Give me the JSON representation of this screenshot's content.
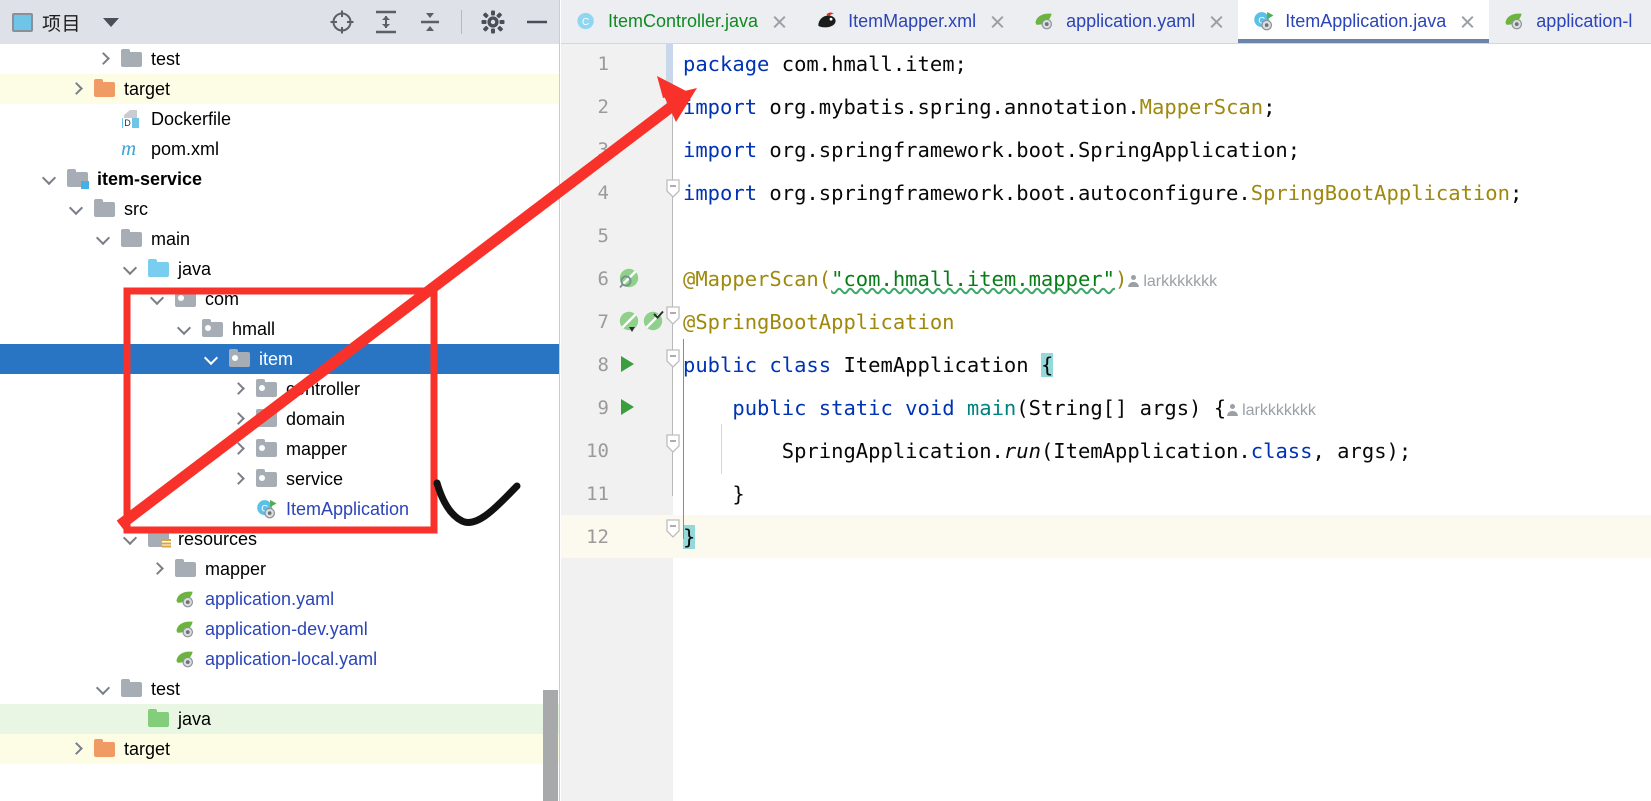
{
  "sidebar": {
    "header": {
      "title": "项目",
      "project_icon": "project-window-icon",
      "caret": "chevron-down-icon",
      "tools": [
        {
          "name": "locate-icon",
          "label": "Select Opened File"
        },
        {
          "name": "expand-all-icon",
          "label": "Expand All"
        },
        {
          "name": "collapse-all-icon",
          "label": "Collapse All"
        },
        {
          "name": "gear-icon",
          "label": "Settings"
        },
        {
          "name": "minimize-icon",
          "label": "Hide"
        }
      ]
    },
    "tree": [
      {
        "label": "test",
        "indent": 3,
        "chevron": "right",
        "icon": "folder-grey",
        "state": "normal"
      },
      {
        "label": "target",
        "indent": 2,
        "chevron": "right",
        "icon": "folder-orange",
        "state": "yellow"
      },
      {
        "label": "Dockerfile",
        "indent": 3,
        "chevron": "none",
        "icon": "docker-file",
        "state": "normal"
      },
      {
        "label": "pom.xml",
        "indent": 3,
        "chevron": "none",
        "icon": "maven-m",
        "state": "normal"
      },
      {
        "label": "item-service",
        "indent": 1,
        "chevron": "down",
        "icon": "folder-module",
        "state": "normal",
        "bold": true
      },
      {
        "label": "src",
        "indent": 2,
        "chevron": "down",
        "icon": "folder-grey",
        "state": "normal"
      },
      {
        "label": "main",
        "indent": 3,
        "chevron": "down",
        "icon": "folder-grey",
        "state": "normal"
      },
      {
        "label": "java",
        "indent": 4,
        "chevron": "down",
        "icon": "folder-blue",
        "state": "normal"
      },
      {
        "label": "com",
        "indent": 5,
        "chevron": "down",
        "icon": "folder-package",
        "state": "normal"
      },
      {
        "label": "hmall",
        "indent": 6,
        "chevron": "down",
        "icon": "folder-package",
        "state": "normal"
      },
      {
        "label": "item",
        "indent": 7,
        "chevron": "down",
        "icon": "folder-package",
        "state": "selected"
      },
      {
        "label": "controller",
        "indent": 8,
        "chevron": "right",
        "icon": "folder-package",
        "state": "normal"
      },
      {
        "label": "domain",
        "indent": 8,
        "chevron": "right",
        "icon": "folder-package",
        "state": "normal"
      },
      {
        "label": "mapper",
        "indent": 8,
        "chevron": "right",
        "icon": "folder-package",
        "state": "normal"
      },
      {
        "label": "service",
        "indent": 8,
        "chevron": "right",
        "icon": "folder-package",
        "state": "normal"
      },
      {
        "label": "ItemApplication",
        "indent": 8,
        "chevron": "none",
        "icon": "java-class-run",
        "state": "normal",
        "blue": true
      },
      {
        "label": "resources",
        "indent": 4,
        "chevron": "down",
        "icon": "folder-resources",
        "state": "normal"
      },
      {
        "label": "mapper",
        "indent": 5,
        "chevron": "right",
        "icon": "folder-grey",
        "state": "normal"
      },
      {
        "label": "application.yaml",
        "indent": 5,
        "chevron": "none",
        "icon": "spring-yaml",
        "state": "normal",
        "blue": true
      },
      {
        "label": "application-dev.yaml",
        "indent": 5,
        "chevron": "none",
        "icon": "spring-yaml",
        "state": "normal",
        "blue": true
      },
      {
        "label": "application-local.yaml",
        "indent": 5,
        "chevron": "none",
        "icon": "spring-yaml",
        "state": "normal",
        "blue": true
      },
      {
        "label": "test",
        "indent": 3,
        "chevron": "down",
        "icon": "folder-grey",
        "state": "normal"
      },
      {
        "label": "java",
        "indent": 4,
        "chevron": "none",
        "icon": "folder-green",
        "state": "green"
      },
      {
        "label": "target",
        "indent": 2,
        "chevron": "right",
        "icon": "folder-orange",
        "state": "yellow"
      }
    ]
  },
  "editor": {
    "tabs": [
      {
        "label": "ItemController.java",
        "icon": "java-class-icon",
        "color": "green",
        "active": false,
        "closable": true
      },
      {
        "label": "ItemMapper.xml",
        "icon": "mybatis-icon",
        "color": "blue",
        "active": false,
        "closable": true
      },
      {
        "label": "application.yaml",
        "icon": "spring-yaml-icon",
        "color": "blue",
        "active": false,
        "closable": true
      },
      {
        "label": "ItemApplication.java",
        "icon": "java-class-run-icon",
        "color": "blue",
        "active": true,
        "closable": true
      },
      {
        "label": "application-l",
        "icon": "spring-yaml-icon",
        "color": "blue",
        "active": false,
        "closable": false
      }
    ],
    "lines": [
      {
        "no": "1",
        "current": false,
        "gutter": []
      },
      {
        "no": "2",
        "current": false,
        "gutter": []
      },
      {
        "no": "3",
        "current": false,
        "gutter": []
      },
      {
        "no": "4",
        "current": false,
        "gutter": []
      },
      {
        "no": "5",
        "current": false,
        "gutter": []
      },
      {
        "no": "6",
        "current": false,
        "gutter": [
          "bean-search-icon"
        ]
      },
      {
        "no": "7",
        "current": false,
        "gutter": [
          "bean-icon",
          "bean-check-icon"
        ]
      },
      {
        "no": "8",
        "current": false,
        "gutter": [
          "run-icon"
        ]
      },
      {
        "no": "9",
        "current": false,
        "gutter": [
          "run-icon"
        ]
      },
      {
        "no": "10",
        "current": false,
        "gutter": []
      },
      {
        "no": "11",
        "current": false,
        "gutter": []
      },
      {
        "no": "12",
        "current": true,
        "gutter": []
      }
    ],
    "code": {
      "l1_kw": "package",
      "l1_rest": " com.hmall.item;",
      "l2_kw": "import",
      "l2_rest": " org.mybatis.spring.annotation.",
      "l2_type": "MapperScan",
      "l2_end": ";",
      "l3_kw": "import",
      "l3_rest": " org.springframework.boot.SpringApplication;",
      "l4_kw": "import",
      "l4_rest": " org.springframework.boot.autoconfigure.",
      "l4_type": "SpringBootApplication",
      "l4_end": ";",
      "l6_ann": "@MapperScan(",
      "l6_str": "\"com.hmall.item.mapper\"",
      "l6_close": ")",
      "l6_hint": "larkkkkkkk",
      "l7_ann": "@SpringBootApplication",
      "l8_kw1": "public",
      "l8_kw2": " class",
      "l8_name": " ItemApplication ",
      "l8_brace": "{",
      "l9_kw": "public static void",
      "l9_meth": " main",
      "l9_rest": "(String[] args) {",
      "l9_hint": "larkkkkkkk",
      "l10_a": "SpringApplication.",
      "l10_run": "run",
      "l10_b": "(ItemApplication.",
      "l10_class": "class",
      "l10_c": ", args);",
      "l11": "}",
      "l12": "}"
    }
  },
  "annotations": {
    "red_box": "red-highlight-rectangle",
    "red_arrow": "red-arrow-pointing-to-package-statement",
    "black_check": "black-check-mark-near-itemapplication"
  },
  "colors": {
    "selection_blue": "#2a74c4",
    "annotation_red": "#f8322a",
    "annotation_black": "#111111",
    "current_line": "#fcfaef",
    "highlight_yellow": "#fdfce4",
    "highlight_green": "#e9f6e4",
    "keyword_blue": "#0033b3",
    "string_green": "#067d17",
    "annotation_olive": "#9e880d",
    "tab_active_underline": "#6b85a8"
  }
}
